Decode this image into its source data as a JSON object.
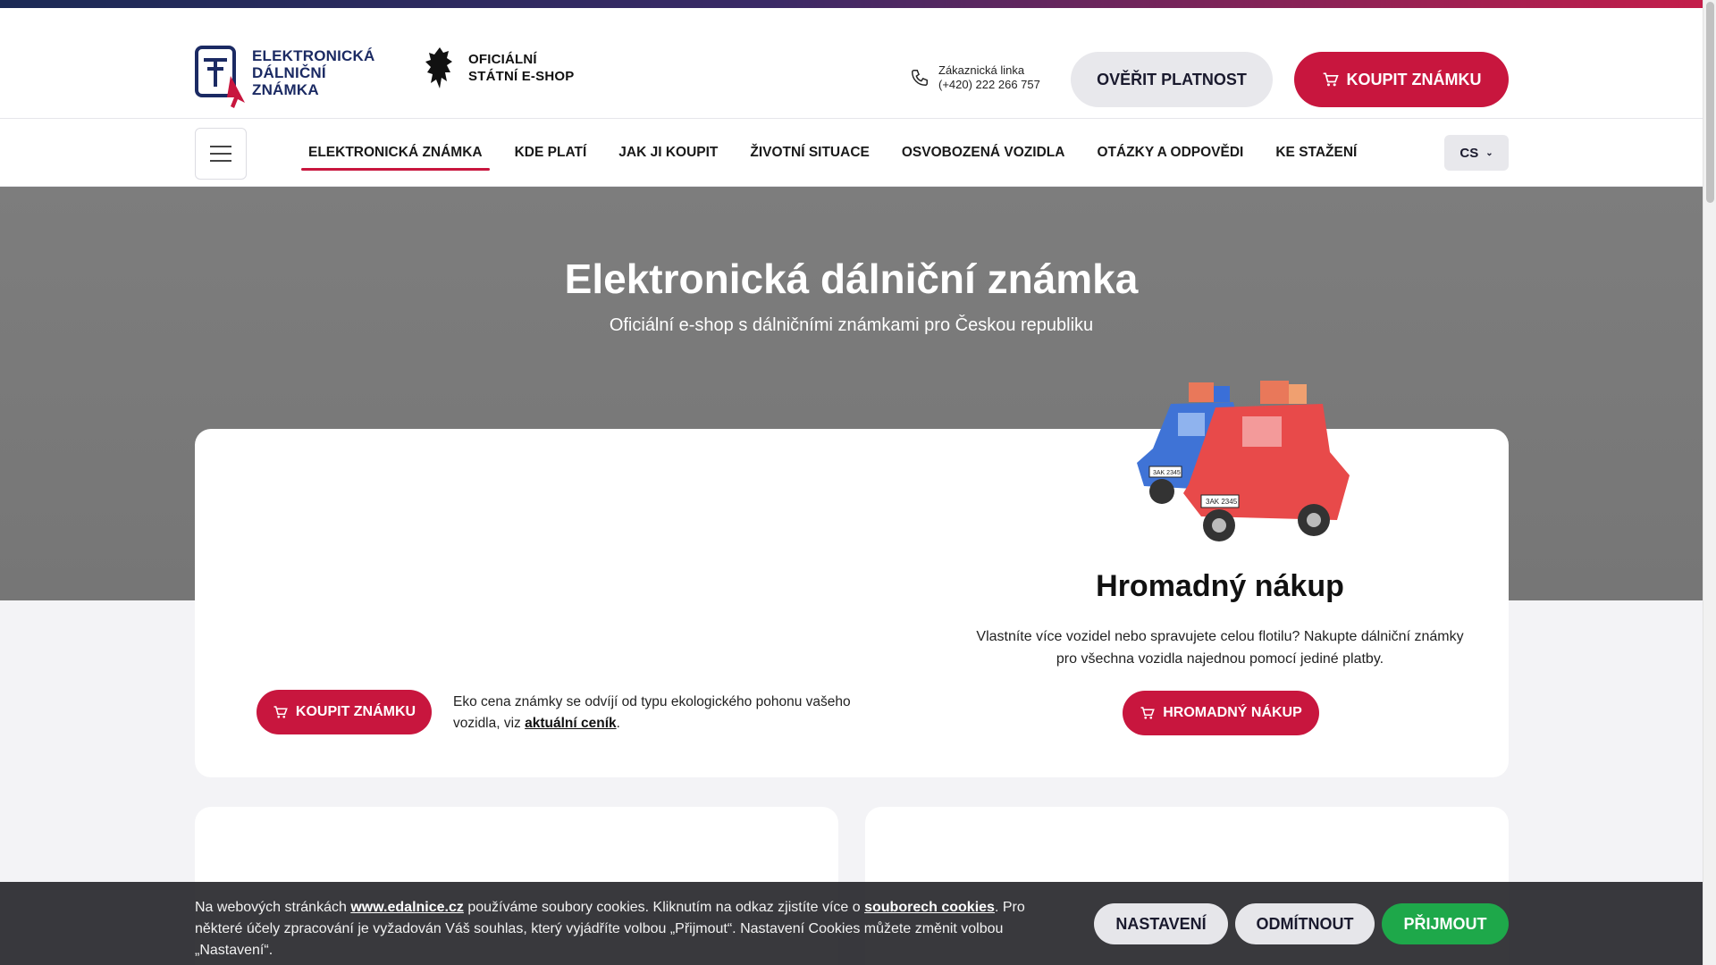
{
  "header": {
    "logo_lines": [
      "ELEKTRONICKÁ",
      "DÁLNIČNÍ ZNÁMKA"
    ],
    "eshop_lines": [
      "OFICIÁLNÍ",
      "STÁTNÍ E-SHOP"
    ],
    "phone_label": "Zákaznická linka",
    "phone_number": "(+420) 222 266 757",
    "verify_label": "OVĚŘIT PLATNOST",
    "buy_label": "KOUPIT ZNÁMKU"
  },
  "nav": {
    "items": [
      {
        "label": "ELEKTRONICKÁ ZNÁMKA",
        "active": true
      },
      {
        "label": "KDE PLATÍ"
      },
      {
        "label": "JAK JI KOUPIT"
      },
      {
        "label": "ŽIVOTNÍ SITUACE"
      },
      {
        "label": "OSVOBOZENÁ VOZIDLA"
      },
      {
        "label": "OTÁZKY A ODPOVĚDI"
      },
      {
        "label": "KE STAŽENÍ"
      }
    ],
    "language": "CS"
  },
  "hero": {
    "title": "Elektronická dálniční známka",
    "subtitle": "Oficiální e-shop s dálničními známkami pro Českou republiku"
  },
  "main_card": {
    "buy_label": "KOUPIT ZNÁMKU",
    "eco_text": "Eko cena známky se odvíjí od typu ekologického pohonu vašeho vozidla, viz",
    "eco_link": "aktuální ceník",
    "eco_end": ".",
    "bulk_title": "Hromadný nákup",
    "bulk_text": "Vlastníte více vozidel nebo spravujete celou flotilu? Nakupte dálniční známky pro všechna vozidla najednou pomocí jediné platby.",
    "bulk_button": "HROMADNÝ NÁKUP",
    "plates": [
      "3AK 2345",
      "3AK 2345"
    ]
  },
  "cookie": {
    "text_1": "Na webových stránkách",
    "link_site": "www.edalnice.cz",
    "text_2": "používáme soubory cookies. Kliknutím na odkaz zjistíte více o",
    "link_cookies": "souborech cookies",
    "text_3": ". Pro některé účely zpracování je vyžadován Váš souhlas, který vyjádříte volbou „Přijmout“. Nastavení Cookies můžete změnit volbou „Nastavení“.",
    "settings_label": "NASTAVENÍ",
    "decline_label": "ODMÍTNOUT",
    "accept_label": "PŘIJMOUT"
  },
  "colors": {
    "brand_red": "#c8163e",
    "navy": "#1b2a63",
    "accept_green": "#1ea84a"
  }
}
